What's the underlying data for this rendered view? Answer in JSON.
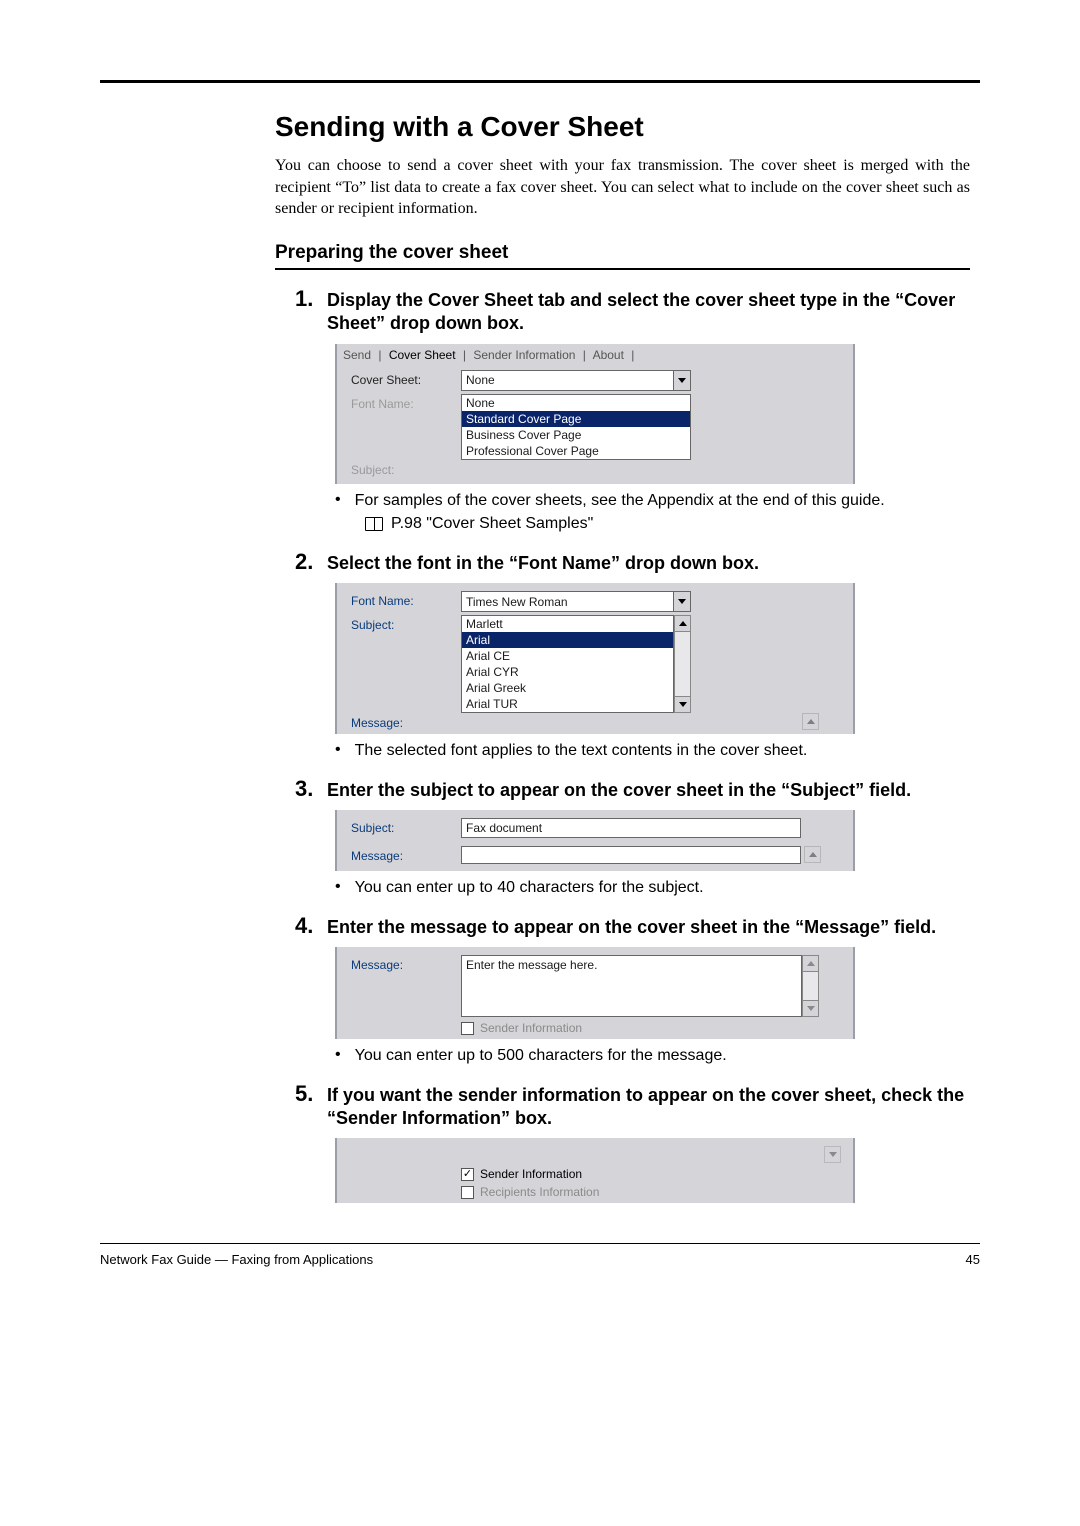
{
  "title": "Sending with a Cover Sheet",
  "intro": "You can choose to send a cover sheet with your fax transmission. The cover sheet is merged with the recipient “To” list data to create a fax cover sheet. You can select what to include on the cover sheet such as sender or recipient information.",
  "subhead": "Preparing the cover sheet",
  "steps": {
    "s1": {
      "num": "1.",
      "text": "Display the Cover Sheet tab and select the cover sheet type in the “Cover Sheet” drop down box.",
      "tabs": {
        "send": "Send",
        "cover": "Cover Sheet",
        "sender": "Sender Information",
        "about": "About"
      },
      "labels": {
        "cover": "Cover Sheet:",
        "font": "Font Name:",
        "subject": "Subject:"
      },
      "combo_value": "None",
      "options": {
        "o1": "None",
        "o2": "Standard Cover Page",
        "o3": "Business Cover Page",
        "o4": "Professional Cover Page"
      },
      "bullet": "For samples of the cover sheets, see the Appendix at the end of this guide.",
      "ref": "P.98 \"Cover Sheet Samples\""
    },
    "s2": {
      "num": "2.",
      "text": "Select the font in the “Font Name” drop down box.",
      "labels": {
        "font": "Font Name:",
        "subject": "Subject:",
        "message": "Message:"
      },
      "combo_value": "Times New Roman",
      "options": {
        "o1": "Marlett",
        "o2": "Arial",
        "o3": "Arial CE",
        "o4": "Arial CYR",
        "o5": "Arial Greek",
        "o6": "Arial TUR"
      },
      "bullet": "The selected font applies to the text contents in the cover sheet."
    },
    "s3": {
      "num": "3.",
      "text": "Enter the subject to appear on the cover sheet in the “Subject” field.",
      "labels": {
        "subject": "Subject:",
        "message": "Message:"
      },
      "value": "Fax document",
      "bullet": "You can enter up to 40 characters for the subject."
    },
    "s4": {
      "num": "4.",
      "text": "Enter the message to appear on the cover sheet in the “Message” field.",
      "labels": {
        "message": "Message:"
      },
      "value": "Enter the message here.",
      "checkbox": "Sender Information",
      "bullet": "You can enter up to 500 characters for the message."
    },
    "s5": {
      "num": "5.",
      "text": "If you want the sender information to appear on the cover sheet, check the “Sender Information” box.",
      "checkbox1": "Sender Information",
      "checkbox2": "Recipients Information"
    }
  },
  "footer": {
    "left": "Network Fax Guide — Faxing from Applications",
    "right": "45"
  }
}
